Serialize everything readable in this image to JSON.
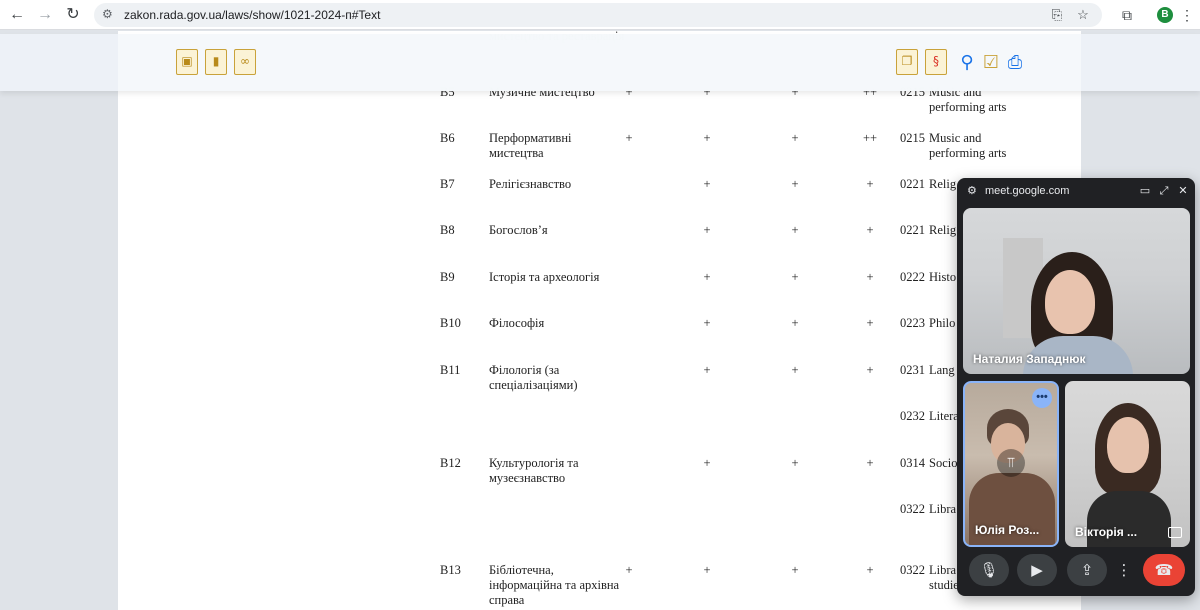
{
  "browser": {
    "url": "zakon.rada.gov.ua/laws/show/1021-2024-п#Text",
    "profile_initial": "B"
  },
  "icons": {
    "back": "arrow-left-icon",
    "forward": "arrow-right-icon",
    "reload": "reload-icon",
    "site_info": "tune-icon",
    "install": "install-app-icon",
    "bookmark": "star-icon",
    "extensions": "puzzle-icon",
    "menu": "kebab-menu-icon"
  },
  "doc_toolbar": {
    "left_icons": [
      "briefcase-doc-icon",
      "bookmark-doc-icon",
      "link-doc-icon"
    ],
    "right_icons": [
      "copy-doc-icon",
      "section-doc-icon",
      "search-icon",
      "check-icon",
      "print-icon"
    ],
    "section_symbol": "§"
  },
  "table": {
    "top_partial": {
      "name": "мистецтво та реставрація"
    },
    "rows": [
      {
        "code": "B5",
        "name": "Музичне мистецтво",
        "marks": [
          "+",
          "+",
          "+",
          "++"
        ],
        "isced": "0215",
        "isced_name": "Music and performing arts"
      },
      {
        "code": "B6",
        "name": "Перформативні мистецтва",
        "marks": [
          "+",
          "+",
          "+",
          "++"
        ],
        "isced": "0215",
        "isced_name": "Music and performing arts"
      },
      {
        "code": "B7",
        "name": "Релігієзнавство",
        "marks": [
          "",
          "+",
          "+",
          "+"
        ],
        "isced": "0221",
        "isced_name": "Relig theol"
      },
      {
        "code": "B8",
        "name": "Богослов’я",
        "marks": [
          "",
          "+",
          "+",
          "+"
        ],
        "isced": "0221",
        "isced_name": "Relig theol"
      },
      {
        "code": "B9",
        "name": "Історія та археологія",
        "marks": [
          "",
          "+",
          "+",
          "+"
        ],
        "isced": "0222",
        "isced_name": "Histo archa"
      },
      {
        "code": "B10",
        "name": "Філософія",
        "marks": [
          "",
          "+",
          "+",
          "+"
        ],
        "isced": "0223",
        "isced_name": "Philo ethics"
      },
      {
        "code": "B11",
        "name": "Філологія (за спеціалізаціями)",
        "marks": [
          "",
          "+",
          "+",
          "+"
        ],
        "isced": "0231",
        "isced_name": "Lang acqui"
      },
      {
        "code": "",
        "name": "",
        "marks": [
          "",
          "",
          "",
          ""
        ],
        "isced": "0232",
        "isced_name": "Litera lingu"
      },
      {
        "code": "B12",
        "name": "Культурологія та музеєзнавство",
        "marks": [
          "",
          "+",
          "+",
          "+"
        ],
        "isced": "0314",
        "isced_name": "Socio cultu"
      },
      {
        "code": "",
        "name": "",
        "marks": [
          "",
          "",
          "",
          ""
        ],
        "isced": "0322",
        "isced_name": "Libra infor archi"
      },
      {
        "code": "B13",
        "name": "Бібліотечна, інформаційна та архівна справа",
        "marks": [
          "+",
          "+",
          "+",
          "+"
        ],
        "isced": "0322",
        "isced_name": "Libra infor archival studies"
      }
    ]
  },
  "meet": {
    "site": "meet.google.com",
    "participants": [
      {
        "name": "Наталия Западнюк"
      },
      {
        "name": "Юлія Роз..."
      },
      {
        "name": "Вікторія ..."
      }
    ],
    "more_symbol": "•••",
    "pin_symbol": "⫪",
    "controls": [
      "mic-icon",
      "camera-icon",
      "present-icon",
      "more-icon",
      "end-call-icon"
    ]
  }
}
